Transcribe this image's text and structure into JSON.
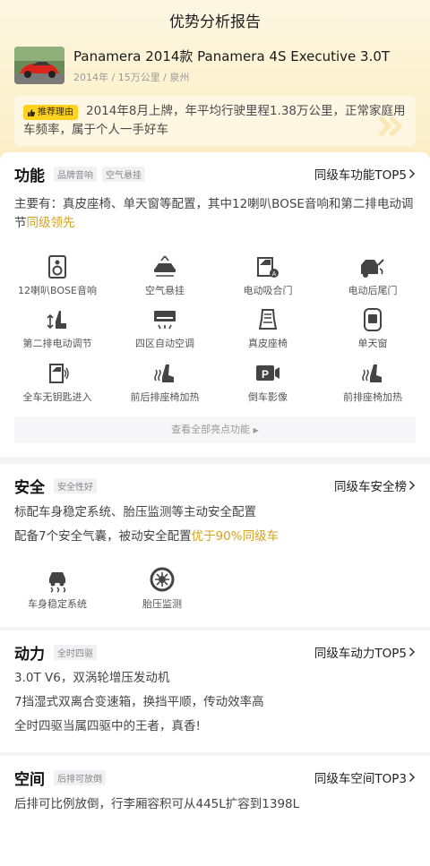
{
  "page": {
    "title": "优势分析报告"
  },
  "car": {
    "name": "Panamera 2014款 Panamera 4S Executive 3.0T",
    "meta": "2014年 / 15万公里 / 泉州"
  },
  "reason": {
    "tag": "推荐理由",
    "text": "2014年8月上牌，年平均行驶里程1.38万公里，正常家庭用车频率，属于个人一手好车"
  },
  "function": {
    "title": "功能",
    "chips": [
      "品牌音响",
      "空气悬挂"
    ],
    "link": "同级车功能TOP5",
    "desc_plain": "主要有：真皮座椅、单天窗等配置，其中12喇叭BOSE音响和第二排电动调节",
    "desc_highlight": "同级领先",
    "features": [
      {
        "label": "12喇叭BOSE音响",
        "icon": "speaker-icon"
      },
      {
        "label": "空气悬挂",
        "icon": "air-suspension-icon"
      },
      {
        "label": "电动吸合门",
        "icon": "soft-close-door-icon"
      },
      {
        "label": "电动后尾门",
        "icon": "power-tailgate-icon"
      },
      {
        "label": "第二排电动调节",
        "icon": "rear-seat-adjust-icon"
      },
      {
        "label": "四区自动空调",
        "icon": "climate-control-icon"
      },
      {
        "label": "真皮座椅",
        "icon": "leather-seat-icon"
      },
      {
        "label": "单天窗",
        "icon": "sunroof-icon"
      },
      {
        "label": "全车无钥匙进入",
        "icon": "keyless-entry-icon"
      },
      {
        "label": "前后排座椅加热",
        "icon": "heated-seats-icon"
      },
      {
        "label": "倒车影像",
        "icon": "reverse-camera-icon"
      },
      {
        "label": "前排座椅加热",
        "icon": "front-heated-seat-icon"
      }
    ],
    "view_all": "查看全部亮点功能"
  },
  "safety": {
    "title": "安全",
    "chip": "安全性好",
    "link": "同级车安全榜",
    "line1": "标配车身稳定系统、胎压监测等主动安全配置",
    "line2_plain": "配备7个安全气囊，被动安全配置",
    "line2_highlight": "优于90%同级车",
    "features": [
      {
        "label": "车身稳定系统",
        "icon": "stability-control-icon"
      },
      {
        "label": "胎压监测",
        "icon": "tire-pressure-icon"
      }
    ]
  },
  "power": {
    "title": "动力",
    "chip": "全时四驱",
    "link": "同级车动力TOP5",
    "lines": [
      "3.0T V6，双涡轮增压发动机",
      "7挡湿式双离合变速箱，换挡平顺，传动效率高",
      "全时四驱当属四驱中的王者，真香!"
    ]
  },
  "space": {
    "title": "空间",
    "chip": "后排可放倒",
    "link": "同级车空间TOP3",
    "line": "后排可比例放倒，行李厢容积可从445L扩容到1398L"
  },
  "colors": {
    "accent": "#d4a21c",
    "tag": "#ffd21e"
  }
}
